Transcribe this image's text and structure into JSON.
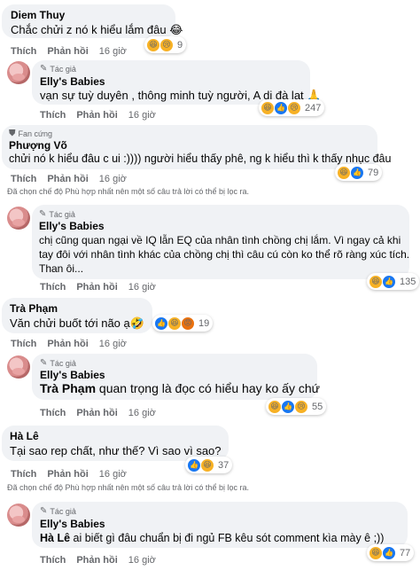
{
  "actions": {
    "like": "Thích",
    "reply": "Phản hồi",
    "time": "16 giờ"
  },
  "tags": {
    "author": "Tác giả",
    "fan": "Fan cứng"
  },
  "notice": "Đã chọn chế độ Phù hợp nhất nên một số câu trả lời có thể bị lọc ra.",
  "comments": [
    {
      "name": "Diem Thuy",
      "text": "Chắc chửi z nó k hiểu lắm đâu 😂",
      "count": "9"
    },
    {
      "name": "Elly's Babies",
      "text": "vạn sự tuỳ duyên , thông minh tuỳ người, A di đà lạt 🙏",
      "count": "247"
    },
    {
      "name": "Phượng Võ",
      "text": "chửi nó k hiểu đâu c ui :)))) người hiểu thấy phê, ng k hiểu thì k thấy nhục đâu",
      "count": "79"
    },
    {
      "name": "Elly's Babies",
      "lines": [
        "chị cũng quan ngại về IQ lẫn EQ của nhân tình chồng chị lắm. Vì ngay cả khi",
        "tay đôi với nhân tình khác của chồng chị thì câu cú còn ko thể rõ ràng xúc tích.",
        "Than ôi..."
      ],
      "count": "135"
    },
    {
      "name": "Trà Phạm",
      "text": "Văn chửi buốt tới não ạ🤣",
      "count": "19"
    },
    {
      "name": "Elly's Babies",
      "mention": "Trà Phạm",
      "text": " quan trọng là đọc có hiểu hay ko ấy chứ",
      "count": "55"
    },
    {
      "name": "Hà Lê",
      "text": "Tại sao rep chất, như thế? Vì sao vì sao?",
      "count": "37"
    },
    {
      "name": "Elly's Babies",
      "mention": "Hà Lê",
      "text": " ai biết gì đâu chuẩn bị đi ngủ FB kêu sót comment kìa mày ê ;))",
      "count": "77"
    }
  ]
}
